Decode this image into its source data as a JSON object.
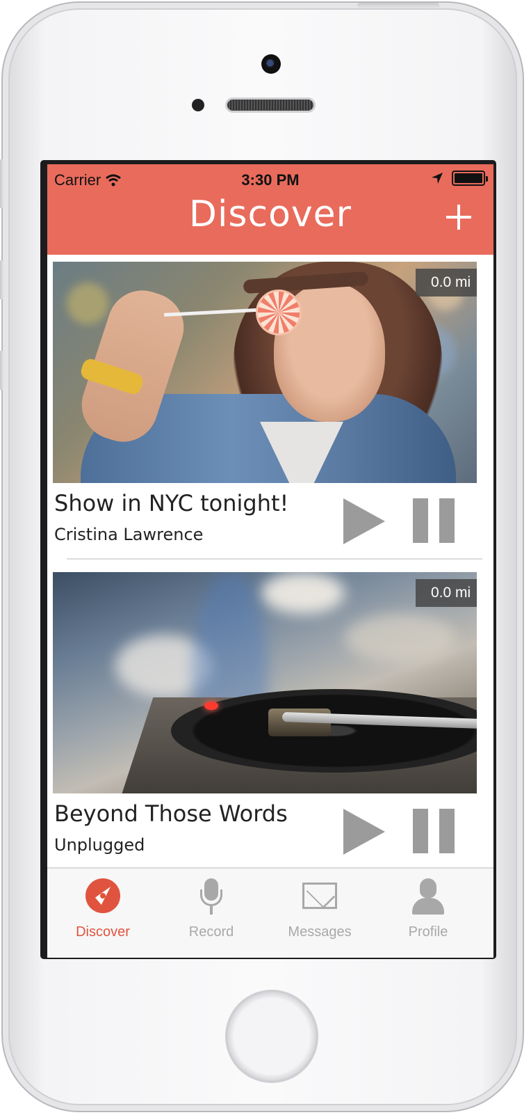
{
  "status_bar": {
    "carrier": "Carrier",
    "time": "3:30 PM"
  },
  "header": {
    "title": "Discover",
    "add_label": "+"
  },
  "feed": [
    {
      "distance": "0.0 mi",
      "title": "Show in NYC tonight!",
      "artist": "Cristina Lawrence",
      "photo": "woman-with-lollipop"
    },
    {
      "distance": "0.0 mi",
      "title": "Beyond Those Words",
      "artist": "Unplugged",
      "photo": "turntable-record"
    }
  ],
  "tabs": [
    {
      "label": "Discover",
      "icon": "compass-icon",
      "active": true
    },
    {
      "label": "Record",
      "icon": "microphone-icon",
      "active": false
    },
    {
      "label": "Messages",
      "icon": "envelope-icon",
      "active": false
    },
    {
      "label": "Profile",
      "icon": "person-icon",
      "active": false
    }
  ],
  "colors": {
    "accent": "#e96b5c",
    "tab_active": "#e0543f",
    "tab_inactive": "#a8a8a8",
    "control_gray": "#9b9b9b"
  }
}
